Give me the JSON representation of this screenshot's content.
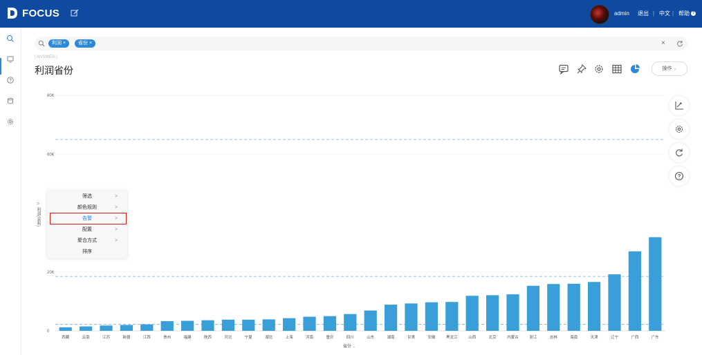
{
  "app": {
    "logo_text": "FOCUS"
  },
  "topbar": {
    "user": "admin",
    "logout": "退出",
    "separator": "|",
    "language": "中文",
    "help": "帮助",
    "help_icon": "?"
  },
  "search": {
    "tokens": [
      "利润",
      "省份"
    ],
    "close_glyph": "×"
  },
  "answer": {
    "label": "ANSWER",
    "title": "利润省份"
  },
  "toolbar": {
    "operate_label": "操作"
  },
  "context_menu": {
    "items": [
      "筛选",
      "颜色规则",
      "告警",
      "配置",
      "聚合方式",
      "排序"
    ],
    "active": "告警",
    "arrow": ">"
  },
  "chart_data": {
    "type": "bar",
    "xlabel": "省份",
    "ylabel": "利润(总和)",
    "ylim": [
      0,
      80000
    ],
    "yticks": [
      0,
      20000,
      60000,
      80000
    ],
    "ytick_labels": [
      "0",
      "20K",
      "60K",
      "80K"
    ],
    "color": "#3a9fd8",
    "reference_lines": [
      65000,
      18500,
      2200
    ],
    "categories": [
      "西藏",
      "云南",
      "江苏",
      "新疆",
      "江西",
      "贵州",
      "福建",
      "陕西",
      "河北",
      "宁夏",
      "湖北",
      "上海",
      "河南",
      "重庆",
      "四川",
      "山东",
      "湖南",
      "甘肃",
      "安徽",
      "黑龙江",
      "山西",
      "北京",
      "内蒙古",
      "浙江",
      "吉林",
      "海南",
      "天津",
      "辽宁",
      "广西",
      "广东"
    ],
    "values": [
      1200,
      1500,
      1800,
      2000,
      2200,
      3300,
      3400,
      3600,
      3800,
      3800,
      3900,
      4300,
      4800,
      5000,
      5700,
      6900,
      8900,
      9300,
      9700,
      9800,
      11900,
      12100,
      12400,
      15300,
      15900,
      16000,
      16600,
      19200,
      27000,
      31800
    ]
  }
}
